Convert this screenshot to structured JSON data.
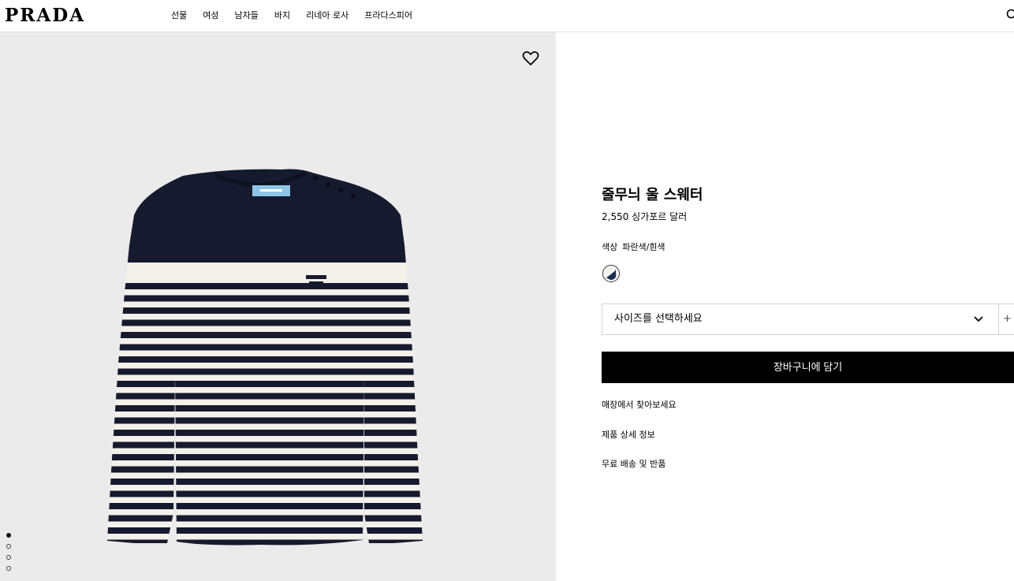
{
  "header": {
    "logo": "PRADA",
    "nav": [
      "선물",
      "여성",
      "남자들",
      "바지",
      "리네아 로사",
      "프라다스피어"
    ]
  },
  "gallery": {
    "slides": 4,
    "active_slide": 1,
    "wishlist_icon": "heart-icon",
    "colors": {
      "navy": "#161a2e",
      "cream": "#f3f1ea",
      "background": "#ebebeb",
      "label_blue": "#8ec5e6"
    }
  },
  "product": {
    "title": "줄무늬 울 스웨터",
    "price": "2,550 싱가포르 달러",
    "color_label": "색상",
    "color_value": "파란색/흰색",
    "size_placeholder": "사이즈를 선택하세요",
    "size_extra": "+",
    "add_to_cart": "장바구니에 담기",
    "links": [
      "매장에서 찾아보세요",
      "제품 상세 정보",
      "무료 배송 및 반품"
    ]
  }
}
